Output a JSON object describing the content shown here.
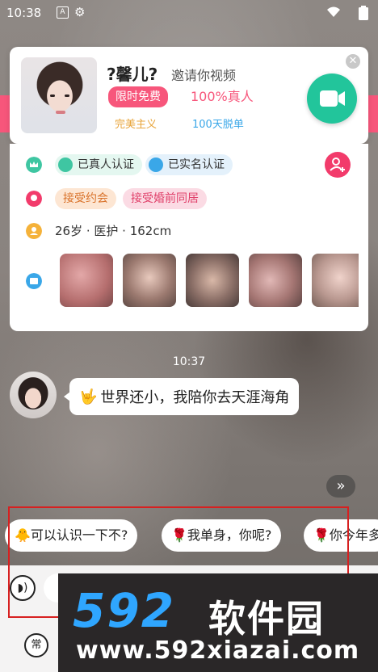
{
  "status_bar": {
    "time": "10:38",
    "notification_letter": "A"
  },
  "invite_card": {
    "name": "?馨儿?",
    "invite_text": "邀请你视频",
    "tag_free": "限时免费",
    "real_person": "100%真人",
    "tag_perfect": "完美主义",
    "tag_100days": "100天脱单",
    "close_icon": "close-icon",
    "video_icon": "video-call-icon",
    "accent_color": "#f7567b",
    "video_color": "#22c59b"
  },
  "profile": {
    "badges": [
      "已真人认证",
      "已实名认证"
    ],
    "accepts": [
      "接受约会",
      "接受婚前同居"
    ],
    "basic_info": "26岁 · 医护 · 162cm"
  },
  "chat": {
    "time": "10:37",
    "message_emoji": "🤟",
    "message_text": "世界还小，我陪你去天涯海角"
  },
  "more_button": "»",
  "quick_replies": [
    {
      "emoji": "🐥",
      "text": "可以认识一下不?"
    },
    {
      "emoji": "🌹",
      "text": "我单身，你呢?"
    },
    {
      "emoji": "🌹",
      "text": "你今年多"
    }
  ],
  "input_bar": {
    "common_label": "常"
  },
  "watermark": {
    "logo": "592",
    "cn": "软件园",
    "url": "www.592xiazai.com"
  }
}
